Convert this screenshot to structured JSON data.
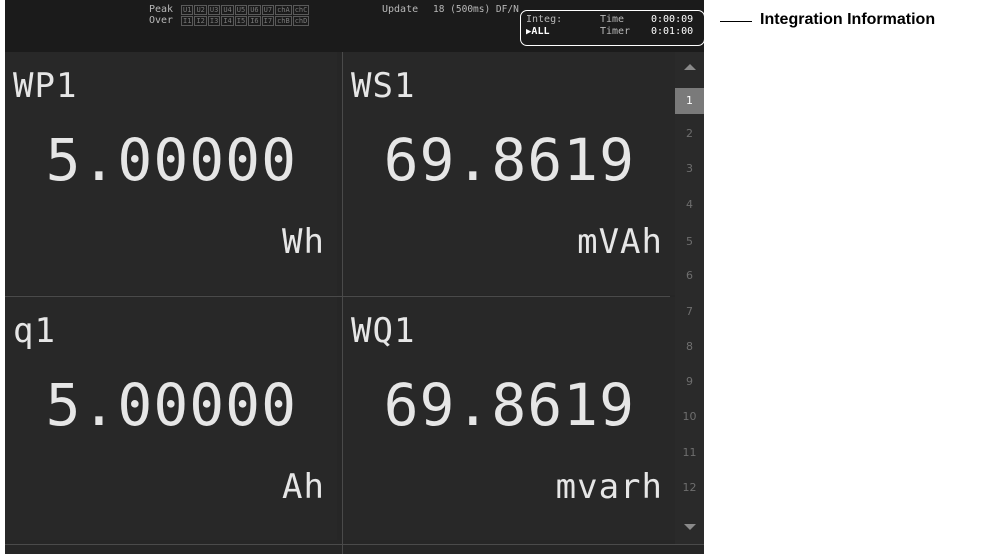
{
  "status_bar": {
    "peak_label": "Peak",
    "over_label": "Over",
    "peak_indicators": [
      "U1",
      "U2",
      "U3",
      "U4",
      "U5",
      "U6",
      "U7",
      "chA",
      "chC"
    ],
    "over_indicators": [
      "I1",
      "I2",
      "I3",
      "I4",
      "I5",
      "I6",
      "I7",
      "chB",
      "chD"
    ],
    "update_label": "Update",
    "update_value": "18 (500ms) DF/N",
    "integ_label": "Integ:",
    "integ_mode": "ALL",
    "time_label": "Time",
    "time_value": "0:00:09",
    "timer_label": "Timer",
    "timer_value": "0:01:00"
  },
  "cells": [
    {
      "name": "WP1",
      "value": "5.00000",
      "unit": "Wh"
    },
    {
      "name": "WS1",
      "value": "69.8619",
      "unit": "mVAh"
    },
    {
      "name": "q1",
      "value": "5.00000",
      "unit": "Ah"
    },
    {
      "name": "WQ1",
      "value": "69.8619",
      "unit": "mvarh"
    }
  ],
  "pages": [
    "1",
    "2",
    "3",
    "4",
    "5",
    "6",
    "7",
    "8",
    "9",
    "10",
    "11",
    "12"
  ],
  "active_page": "1",
  "callout": "Integration Information"
}
